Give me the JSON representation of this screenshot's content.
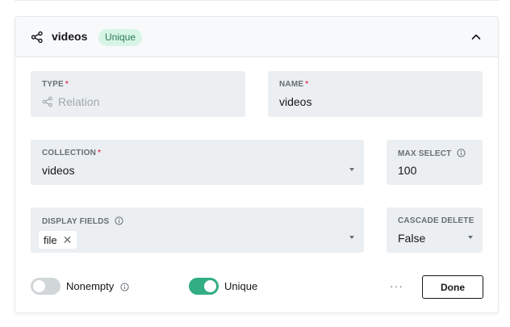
{
  "field": {
    "title": "videos",
    "badge": "Unique"
  },
  "type": {
    "label": "TYPE",
    "required_mark": "*",
    "value": "Relation",
    "icon": "relation-icon"
  },
  "name": {
    "label": "NAME",
    "required_mark": "*",
    "value": "videos"
  },
  "collection": {
    "label": "COLLECTION",
    "required_mark": "*",
    "value": "videos"
  },
  "max_select": {
    "label": "MAX SELECT",
    "value": "100"
  },
  "display_fields": {
    "label": "DISPLAY FIELDS",
    "chips": [
      "file"
    ]
  },
  "cascade_delete": {
    "label": "CASCADE DELETE",
    "value": "False"
  },
  "footer": {
    "nonempty_label": "Nonempty",
    "nonempty_on": false,
    "unique_label": "Unique",
    "unique_on": true,
    "more_label": "···",
    "done_label": "Done"
  },
  "colors": {
    "accent_green": "#32ad84",
    "badge_bg": "#d7f5e6",
    "required_red": "#e34562",
    "field_bg": "#ebeff2"
  }
}
